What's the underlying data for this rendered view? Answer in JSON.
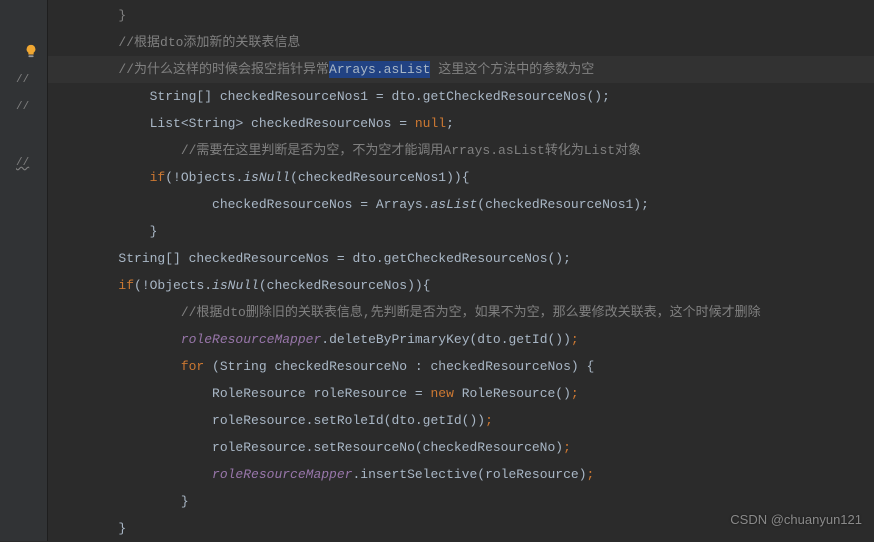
{
  "gutter": {
    "marks": [
      "//",
      "//",
      "//"
    ],
    "bulb_icon": "lightbulb"
  },
  "lines": [
    {
      "indent": 2,
      "type": "partial",
      "text": "}"
    },
    {
      "indent": 2,
      "type": "comment",
      "text": "//根据dto添加新的关联表信息"
    },
    {
      "indent": 2,
      "type": "highlight-comment",
      "prefix": "//为什么这样的时候会报空指针异常",
      "selected": "Arrays.asList",
      "suffix": " 这里这个方法中的参数为空"
    },
    {
      "indent": 3,
      "type": "code",
      "parts": [
        {
          "t": "String[] checkedResourceNos1 = dto.getCheckedResourceNos();",
          "c": "plain"
        }
      ]
    },
    {
      "indent": 3,
      "type": "code",
      "parts": [
        {
          "t": "List<String> checkedResourceNos = ",
          "c": "plain"
        },
        {
          "t": "null",
          "c": "keyword"
        },
        {
          "t": ";",
          "c": "plain"
        }
      ]
    },
    {
      "indent": 4,
      "type": "comment",
      "text": "//需要在这里判断是否为空，不为空才能调用Arrays.asList转化为List对象"
    },
    {
      "indent": 3,
      "type": "code",
      "parts": [
        {
          "t": "if",
          "c": "keyword"
        },
        {
          "t": "(!Objects.",
          "c": "plain"
        },
        {
          "t": "isNull",
          "c": "static"
        },
        {
          "t": "(checkedResourceNos1)){",
          "c": "plain"
        }
      ]
    },
    {
      "indent": 5,
      "type": "code",
      "parts": [
        {
          "t": "checkedResourceNos = Arrays.",
          "c": "plain"
        },
        {
          "t": "asList",
          "c": "static"
        },
        {
          "t": "(checkedResourceNos1);",
          "c": "plain"
        }
      ]
    },
    {
      "indent": 3,
      "type": "code",
      "parts": [
        {
          "t": "}",
          "c": "plain"
        }
      ]
    },
    {
      "indent": 2,
      "type": "code",
      "parts": [
        {
          "t": "String[] checkedResourceNos = dto.getCheckedResourceNos();",
          "c": "plain"
        }
      ]
    },
    {
      "indent": 2,
      "type": "code",
      "parts": [
        {
          "t": "if",
          "c": "keyword"
        },
        {
          "t": "(!Objects.",
          "c": "plain"
        },
        {
          "t": "isNull",
          "c": "static"
        },
        {
          "t": "(checkedResourceNos)){",
          "c": "plain"
        }
      ]
    },
    {
      "indent": 4,
      "type": "comment",
      "text": "//根据dto删除旧的关联表信息,先判断是否为空，如果不为空，那么要修改关联表，这个时候才删除"
    },
    {
      "indent": 4,
      "type": "code",
      "parts": [
        {
          "t": "roleResourceMapper",
          "c": "field"
        },
        {
          "t": ".deleteByPrimaryKey(dto.getId())",
          "c": "plain"
        },
        {
          "t": ";",
          "c": "keyword"
        }
      ]
    },
    {
      "indent": 4,
      "type": "code",
      "parts": [
        {
          "t": "for ",
          "c": "keyword"
        },
        {
          "t": "(String checkedResourceNo : checkedResourceNos) {",
          "c": "plain"
        }
      ]
    },
    {
      "indent": 5,
      "type": "code",
      "parts": [
        {
          "t": "RoleResource roleResource = ",
          "c": "plain"
        },
        {
          "t": "new ",
          "c": "keyword"
        },
        {
          "t": "RoleResource()",
          "c": "plain"
        },
        {
          "t": ";",
          "c": "keyword"
        }
      ]
    },
    {
      "indent": 5,
      "type": "code",
      "parts": [
        {
          "t": "roleResource.setRoleId(dto.getId())",
          "c": "plain"
        },
        {
          "t": ";",
          "c": "keyword"
        }
      ]
    },
    {
      "indent": 5,
      "type": "code",
      "parts": [
        {
          "t": "roleResource.setResourceNo(checkedResourceNo)",
          "c": "plain"
        },
        {
          "t": ";",
          "c": "keyword"
        }
      ]
    },
    {
      "indent": 5,
      "type": "code",
      "parts": [
        {
          "t": "roleResourceMapper",
          "c": "field"
        },
        {
          "t": ".insertSelective(roleResource)",
          "c": "plain"
        },
        {
          "t": ";",
          "c": "keyword"
        }
      ]
    },
    {
      "indent": 4,
      "type": "code",
      "parts": [
        {
          "t": "}",
          "c": "plain"
        }
      ]
    },
    {
      "indent": 2,
      "type": "code",
      "parts": [
        {
          "t": "}",
          "c": "plain"
        }
      ]
    }
  ],
  "watermark": "CSDN @chuanyun121"
}
